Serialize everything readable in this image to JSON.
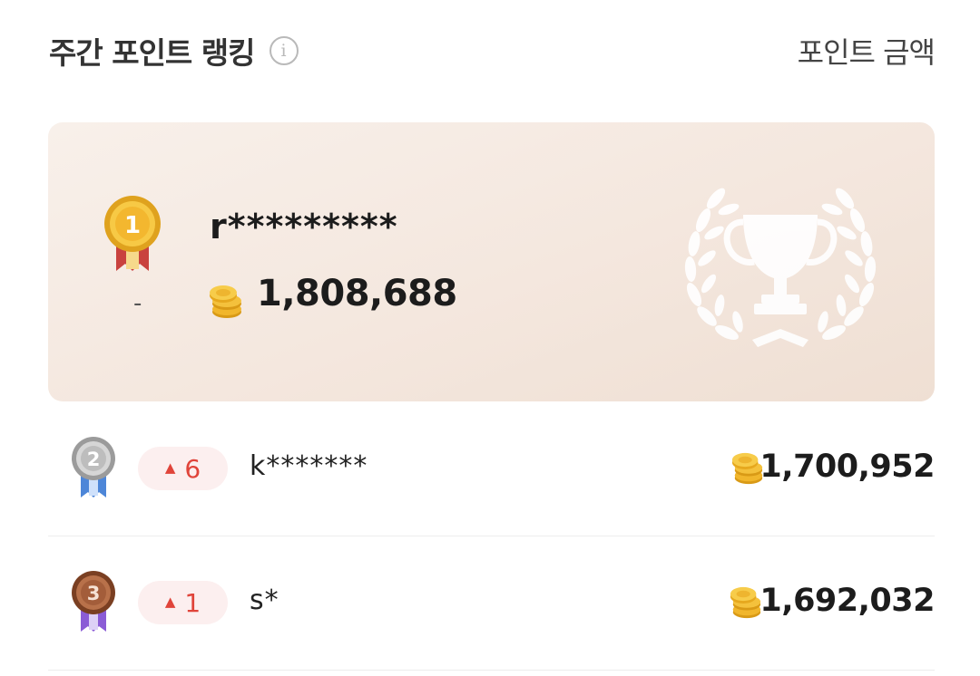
{
  "header": {
    "title": "주간 포인트 랭킹",
    "info_icon": "info-icon",
    "info_glyph": "i",
    "sort_label": "포인트 금액"
  },
  "top": {
    "rank": 1,
    "medal_label": "1",
    "rank_change": "-",
    "name": "r*********",
    "points": "1,808,688"
  },
  "rows": [
    {
      "rank": 2,
      "medal_label": "2",
      "change": "6",
      "direction": "up",
      "name": "k*******",
      "points": "1,700,952"
    },
    {
      "rank": 3,
      "medal_label": "3",
      "change": "1",
      "direction": "up",
      "name": "s*",
      "points": "1,692,032"
    }
  ],
  "colors": {
    "gold": "#e8b534",
    "silver": "#b8b8b8",
    "bronze": "#a35d3a",
    "up": "#e0443a",
    "card_bg": "#f4e7de"
  },
  "icons": {
    "coin": "coin-stack-icon",
    "trophy": "trophy-laurel-icon",
    "up_arrow": "up-triangle-icon"
  }
}
